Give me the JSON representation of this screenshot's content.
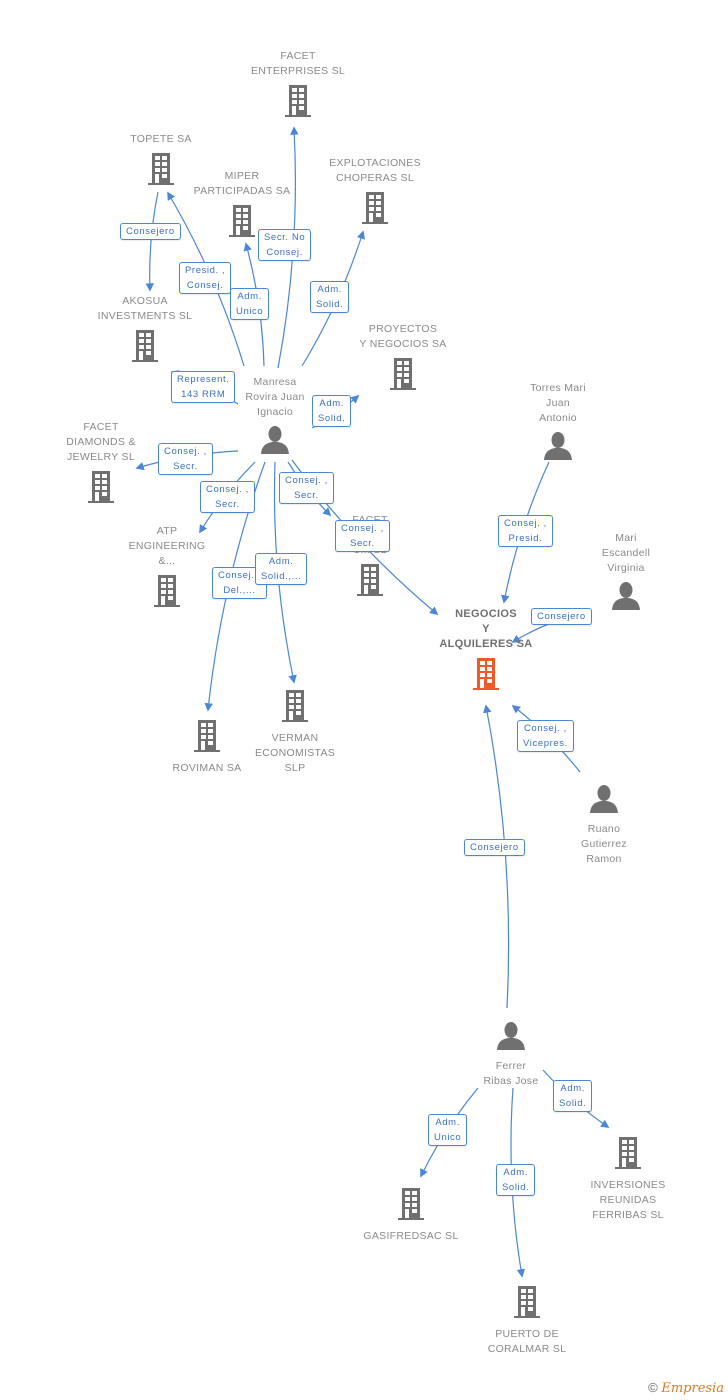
{
  "colors": {
    "edge": "#4a87d6",
    "node_icon": "#707070",
    "focus_icon": "#f05a28",
    "label": "#8a8a8a"
  },
  "nodes": [
    {
      "id": "facet_enterprises",
      "type": "company",
      "label": "FACET\nENTERPRISES SL"
    },
    {
      "id": "topete",
      "type": "company",
      "label": "TOPETE SA"
    },
    {
      "id": "miper",
      "type": "company",
      "label": "MIPER\nPARTICIPADAS SA"
    },
    {
      "id": "explotaciones",
      "type": "company",
      "label": "EXPLOTACIONES\nCHOPERAS SL"
    },
    {
      "id": "akosua",
      "type": "company",
      "label": "AKOSUA\nINVESTMENTS SL"
    },
    {
      "id": "proyectos",
      "type": "company",
      "label": "PROYECTOS\nY NEGOCIOS SA"
    },
    {
      "id": "manresa",
      "type": "person",
      "label": "Manresa\nRovira Juan\nIgnacio"
    },
    {
      "id": "torres",
      "type": "person",
      "label": "Torres Mari\nJuan\nAntonio"
    },
    {
      "id": "facet_diamonds",
      "type": "company",
      "label": "FACET\nDIAMONDS &\nJEWELRY  SL"
    },
    {
      "id": "atp",
      "type": "company",
      "label": "ATP\nENGINEERING\n&..."
    },
    {
      "id": "facet_y",
      "type": "company",
      "label": "FACET\nY\nS...  SL"
    },
    {
      "id": "mari",
      "type": "person",
      "label": "Mari\nEscandell\nVirginia"
    },
    {
      "id": "negocios",
      "type": "focus",
      "label": "NEGOCIOS\nY\nALQUILERES SA"
    },
    {
      "id": "roviman",
      "type": "company",
      "label": "ROVIMAN SA"
    },
    {
      "id": "verman",
      "type": "company",
      "label": "VERMAN\nECONOMISTAS\nSLP"
    },
    {
      "id": "ruano",
      "type": "person",
      "label": "Ruano\nGutierrez\nRamon"
    },
    {
      "id": "ferrer",
      "type": "person",
      "label": "Ferrer\nRibas Jose"
    },
    {
      "id": "gasifredsac",
      "type": "company",
      "label": "GASIFREDSAC SL"
    },
    {
      "id": "inversiones",
      "type": "company",
      "label": "INVERSIONES\nREUNIDAS\nFERRIBAS SL"
    },
    {
      "id": "puerto",
      "type": "company",
      "label": "PUERTO DE\nCORALMAR SL"
    }
  ],
  "edges": [
    {
      "from": "manresa",
      "to": "facet_enterprises",
      "role": "Secr.  No\nConsej."
    },
    {
      "from": "topete",
      "to": "akosua",
      "role": "Consejero"
    },
    {
      "from": "manresa",
      "to": "topete",
      "role": "Presid. ,\nConsej."
    },
    {
      "from": "manresa",
      "to": "miper",
      "role": "Adm.\nUnico"
    },
    {
      "from": "manresa",
      "to": "explotaciones",
      "role": "Adm.\nSolid."
    },
    {
      "from": "manresa",
      "to": "akosua",
      "role": "Represent.\n143 RRM"
    },
    {
      "from": "manresa",
      "to": "proyectos",
      "role": "Adm.\nSolid."
    },
    {
      "from": "manresa",
      "to": "facet_diamonds",
      "role": "Consej. ,\nSecr."
    },
    {
      "from": "manresa",
      "to": "atp",
      "role": "Consej. ,\nSecr."
    },
    {
      "from": "manresa",
      "to": "facet_y",
      "role": "Consej. ,\nSecr."
    },
    {
      "from": "manresa",
      "to": "negocios",
      "role": "Consej. ,\nSecr."
    },
    {
      "from": "manresa",
      "to": "roviman",
      "role": "Consej. ,\nDel.,..."
    },
    {
      "from": "manresa",
      "to": "verman",
      "role": "Adm.\nSolid.,..."
    },
    {
      "from": "torres",
      "to": "negocios",
      "role": "Consej. ,\nPresid."
    },
    {
      "from": "mari",
      "to": "negocios",
      "role": "Consejero"
    },
    {
      "from": "ruano",
      "to": "negocios",
      "role": "Consej. ,\nVicepres."
    },
    {
      "from": "ferrer",
      "to": "negocios",
      "role": "Consejero"
    },
    {
      "from": "ferrer",
      "to": "gasifredsac",
      "role": "Adm.\nUnico"
    },
    {
      "from": "ferrer",
      "to": "inversiones",
      "role": "Adm.\nSolid."
    },
    {
      "from": "ferrer",
      "to": "puerto",
      "role": "Adm.\nSolid."
    }
  ],
  "footer": {
    "copyright": "©",
    "brand": "Empresia"
  }
}
